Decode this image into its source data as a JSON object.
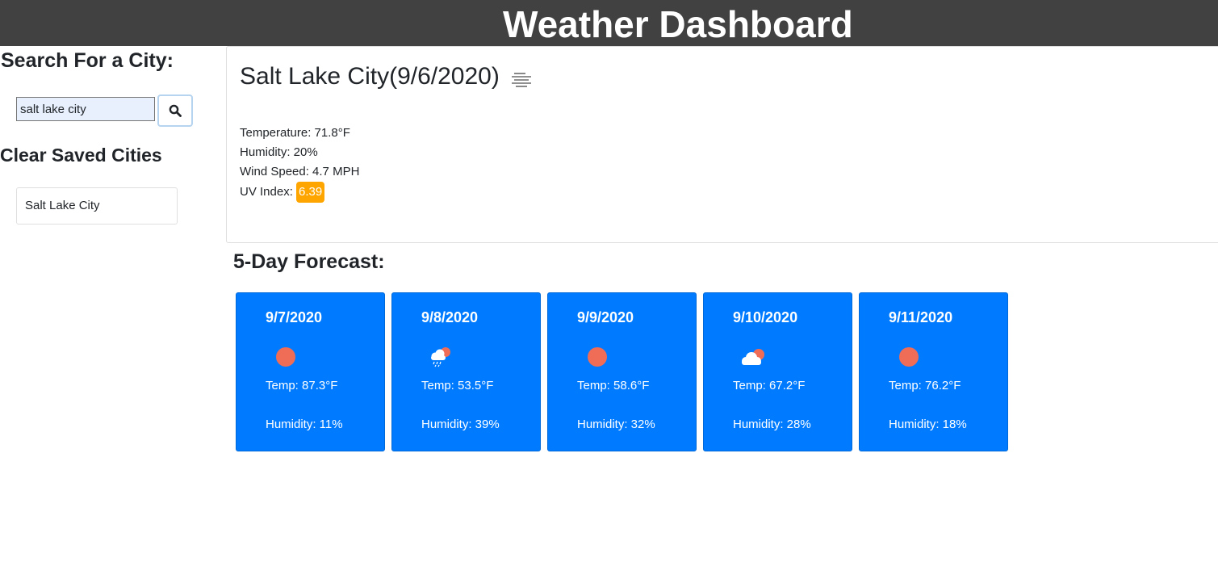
{
  "header": {
    "title": "Weather Dashboard"
  },
  "sidebar": {
    "search_heading": "Search For a City:",
    "search_value": "salt lake city",
    "search_icon": "search-icon",
    "clear_label": "Clear Saved Cities",
    "saved_cities": [
      "Salt Lake City"
    ]
  },
  "current": {
    "title": "Salt Lake City(9/6/2020)",
    "icon": "mist-icon",
    "temperature": "Temperature: 71.8°F",
    "humidity": "Humidity: 20%",
    "wind": "Wind Speed: 4.7 MPH",
    "uv_label": "UV Index:",
    "uv_value": "6.39",
    "uv_color": "#ffa500"
  },
  "forecast": {
    "heading": "5-Day Forecast:",
    "card_color": "#007bff",
    "days": [
      {
        "date": "9/7/2020",
        "icon": "sun-icon",
        "temp": "Temp: 87.3°F",
        "humidity": "Humidity: 11%"
      },
      {
        "date": "9/8/2020",
        "icon": "rain-cloud-sun-icon",
        "temp": "Temp: 53.5°F",
        "humidity": "Humidity: 39%"
      },
      {
        "date": "9/9/2020",
        "icon": "sun-icon",
        "temp": "Temp: 58.6°F",
        "humidity": "Humidity: 32%"
      },
      {
        "date": "9/10/2020",
        "icon": "cloud-sun-icon",
        "temp": "Temp: 67.2°F",
        "humidity": "Humidity: 28%"
      },
      {
        "date": "9/11/2020",
        "icon": "sun-icon",
        "temp": "Temp: 76.2°F",
        "humidity": "Humidity: 18%"
      }
    ]
  }
}
